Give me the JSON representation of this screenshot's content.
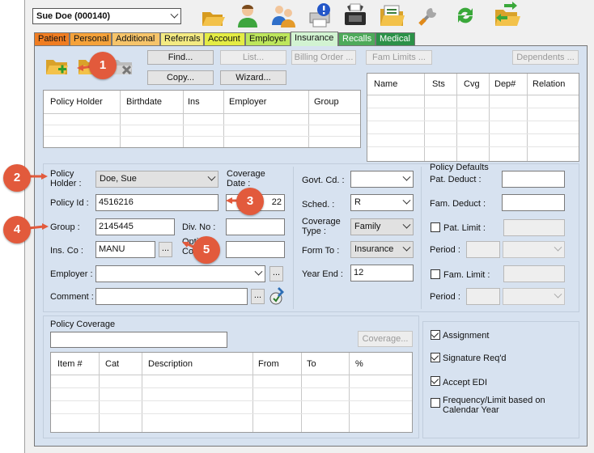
{
  "patient_selector": {
    "value": "Sue Doe (000140)"
  },
  "toolbar_icons": [
    "folder-open-icon",
    "person-icon",
    "family-icon",
    "printer-alert-icon",
    "fax-icon",
    "document-folder-icon",
    "tools-icon",
    "refresh-icon",
    "transfer-folder-icon"
  ],
  "tabs": [
    {
      "label": "Patient",
      "color": "#f07d22"
    },
    {
      "label": "Personal",
      "color": "#f5a23a"
    },
    {
      "label": "Additional",
      "color": "#f6c46a"
    },
    {
      "label": "Referrals",
      "color": "#f3ea82"
    },
    {
      "label": "Account",
      "color": "#e4ec44"
    },
    {
      "label": "Employer",
      "color": "#bde65c"
    },
    {
      "label": "Insurance",
      "color": "#d2f3d2",
      "active": true
    },
    {
      "label": "Recalls",
      "color": "#4eaa5a"
    },
    {
      "label": "Medical",
      "color": "#2b9148"
    }
  ],
  "buttons": {
    "find": "Find...",
    "list": "List...",
    "billing_order": "Billing Order ...",
    "fam_limits": "Fam Limits ...",
    "dependents": "Dependents ...",
    "copy": "Copy...",
    "wizard": "Wizard...",
    "coverage": "Coverage..."
  },
  "policy_grid": {
    "columns": [
      "Policy Holder",
      "Birthdate",
      "Ins",
      "Employer",
      "Group"
    ]
  },
  "dependents_grid": {
    "columns": [
      "Name",
      "Sts",
      "Cvg",
      "Dep#",
      "Relation"
    ]
  },
  "form": {
    "policy_holder_label_1": "Policy",
    "policy_holder_label_2": "Holder :",
    "policy_holder": "Doe, Sue",
    "coverage_date_label_1": "Coverage",
    "coverage_date_label_2": "Date :",
    "coverage_date_partial": "22",
    "policy_id_label": "Policy Id :",
    "policy_id": "4516216",
    "group_label": "Group :",
    "group": "2145445",
    "div_no_label": "Div. No :",
    "div_no": "",
    "ins_co_label": "Ins. Co :",
    "ins_co": "MANU",
    "ins_co_browse": "...",
    "optional_partial_1": "Opti",
    "optional_partial_2": "Co",
    "employer_label": "Employer :",
    "employer": "",
    "employer_browse": "...",
    "comment_label": "Comment :",
    "comment": "",
    "comment_browse": "...",
    "govt_cd_label": "Govt. Cd. :",
    "govt_cd": "",
    "sched_label": "Sched. :",
    "sched": "R",
    "coverage_type_label_1": "Coverage",
    "coverage_type_label_2": "Type :",
    "coverage_type": "Family",
    "form_to_label": "Form To :",
    "form_to": "Insurance",
    "year_end_label": "Year End :",
    "year_end": "12"
  },
  "policy_defaults": {
    "title": "Policy Defaults",
    "pat_deduct_label": "Pat. Deduct :",
    "pat_deduct": "",
    "fam_deduct_label": "Fam. Deduct :",
    "fam_deduct": "",
    "pat_limit_label": "Pat. Limit :",
    "fam_limit_label": "Fam. Limit :",
    "period_label": "Period :"
  },
  "policy_coverage": {
    "title": "Policy Coverage",
    "value": "",
    "columns": [
      "Item #",
      "Cat",
      "Description",
      "From",
      "To",
      "%"
    ]
  },
  "options": [
    {
      "label": "Assignment",
      "checked": true
    },
    {
      "label": "Signature Req'd",
      "checked": true
    },
    {
      "label": "Accept EDI",
      "checked": true
    },
    {
      "label": "Frequency/Limit based on",
      "label2": "Calendar Year",
      "checked": false
    }
  ],
  "callouts": [
    "1",
    "2",
    "3",
    "4",
    "5"
  ]
}
